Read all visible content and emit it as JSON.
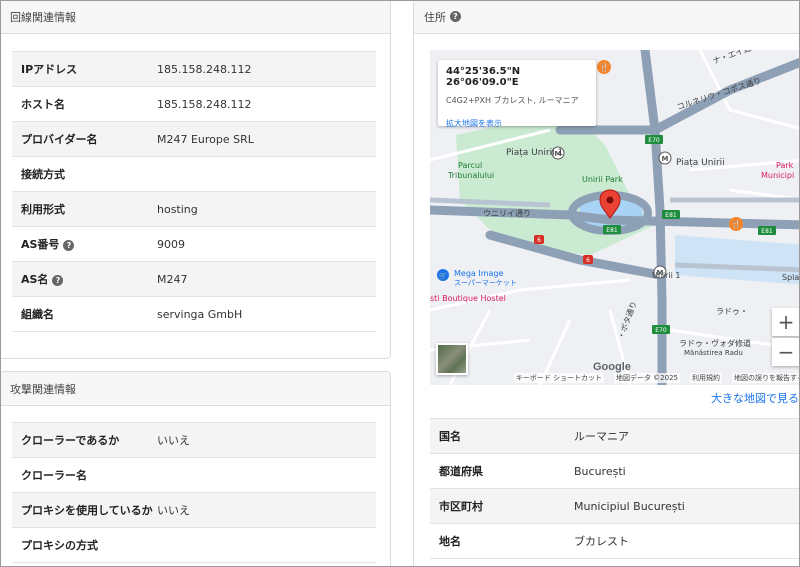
{
  "line_info": {
    "title": "回線関連情報",
    "rows": [
      {
        "label": "IPアドレス",
        "value": "185.158.248.112"
      },
      {
        "label": "ホスト名",
        "value": "185.158.248.112"
      },
      {
        "label": "プロバイダー名",
        "value": "M247 Europe SRL"
      },
      {
        "label": "接続方式",
        "value": ""
      },
      {
        "label": "利用形式",
        "value": "hosting"
      },
      {
        "label": "AS番号",
        "value": "9009"
      },
      {
        "label": "AS名",
        "value": "M247"
      },
      {
        "label": "組織名",
        "value": "servinga GmbH"
      }
    ]
  },
  "attack_info": {
    "title": "攻撃関連情報",
    "rows": [
      {
        "label": "クローラーであるか",
        "value": "いいえ"
      },
      {
        "label": "クローラー名",
        "value": ""
      },
      {
        "label": "プロキシを使用しているか",
        "value": "いいえ"
      },
      {
        "label": "プロキシの方式",
        "value": ""
      }
    ]
  },
  "address": {
    "title": "住所",
    "map": {
      "coords": "44°25'36.5\"N 26°06'09.0\"E",
      "plus_code": "C4G2+PXH ブカレスト, ルーマニア",
      "enlarge_link": "拡大地図を表示",
      "labels": {
        "piata_unirii_1": "Piața Unirii 1",
        "piata_unirii": "Piața Unirii",
        "unirii_park": "Unirii Park",
        "parcul_1": "Parcul",
        "parcul_2": "Tribunalului",
        "unirii_dori": "ウニリイ通り",
        "mega_image_1": "Mega Image",
        "mega_image_2": "スーパーマーケット",
        "boutique": "sti Boutique Hostel",
        "unirii_1": "Unirii 1",
        "corneliu": "コルネリウ・コポス通り",
        "poarta": "ナ・エイ通り",
        "park_right": "Park",
        "municipi": "Municipi",
        "spla": "Spla",
        "radu_voda": "ラドゥ・ヴォダ修道",
        "manastirea": "Mănăstirea Radu",
        "radu": "ラドゥ・",
        "bota": "・ボタ通り",
        "road_e70": "E70",
        "road_e81": "E81",
        "road_6": "6",
        "google": "Google"
      },
      "zoom_in": "+",
      "zoom_out": "−",
      "attribution": [
        "キーボード ショートカット",
        "地図データ ©2025",
        "利用規約",
        "地図の誤りを報告する"
      ]
    },
    "big_map_link": "大きな地図で見る",
    "rows": [
      {
        "label": "国名",
        "value": "ルーマニア"
      },
      {
        "label": "都道府県",
        "value": "București"
      },
      {
        "label": "市区町村",
        "value": "Municipiul București"
      },
      {
        "label": "地名",
        "value": "ブカレスト"
      }
    ]
  },
  "icons": {
    "help": "question-circle-icon",
    "pin": "map-pin-icon",
    "restaurant": "restaurant-icon",
    "metro": "metro-icon",
    "shop": "shopping-cart-icon"
  },
  "colors": {
    "link": "#1a73e8",
    "pin": "#ea4335",
    "park": "#cbead2",
    "road": "#8ea0b5"
  }
}
